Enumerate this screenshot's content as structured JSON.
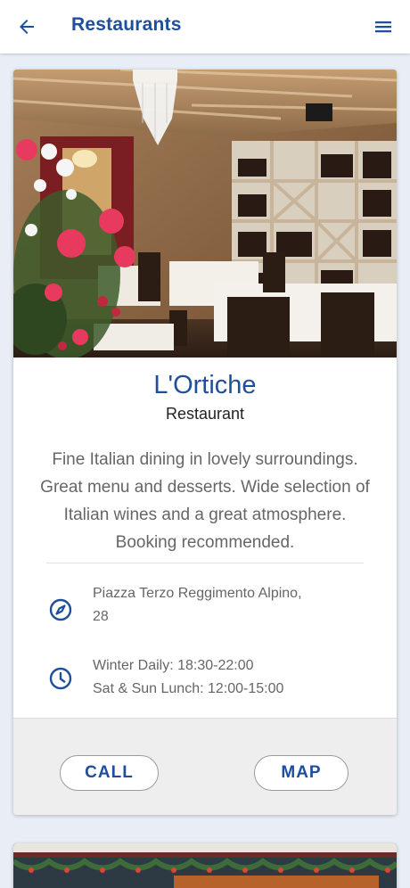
{
  "header": {
    "title": "Restaurants",
    "back_icon": "arrow-left-icon",
    "menu_icon": "hamburger-menu-icon"
  },
  "restaurant": {
    "name": "L'Ortiche",
    "type": "Restaurant",
    "description": "Fine Italian dining in lovely surroundings. Great menu and desserts. Wide selection of Italian wines and a great atmosphere. Booking recommended.",
    "address_line1": "Piazza Terzo Reggimento Alpino,",
    "address_line2": "28",
    "hours_line1": "Winter Daily: 18:30-22:00",
    "hours_line2": "Sat & Sun Lunch: 12:00-15:00",
    "address_icon": "compass-icon",
    "hours_icon": "clock-icon"
  },
  "actions": {
    "call_label": "CALL",
    "map_label": "MAP"
  },
  "colors": {
    "accent": "#1f4f9b",
    "background": "#e9eef6",
    "muted_text": "#666666"
  }
}
